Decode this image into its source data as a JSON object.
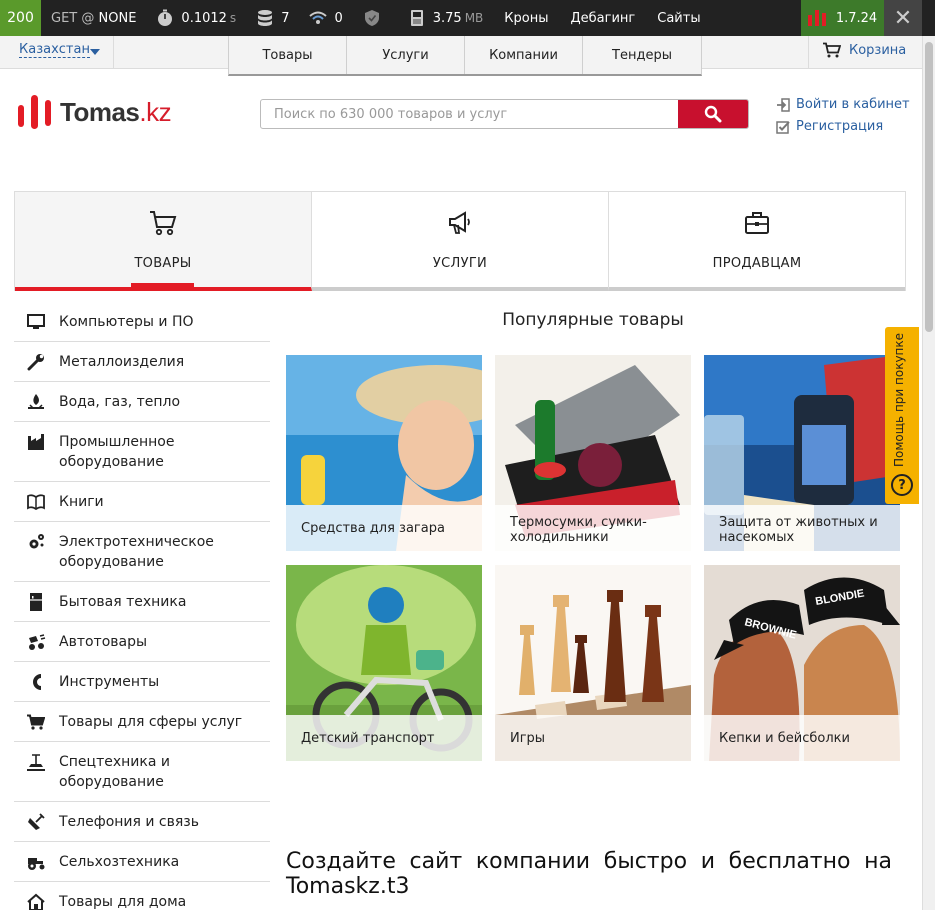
{
  "debug": {
    "status": "200",
    "request_method": "GET @",
    "request_route": "NONE",
    "time": "0.1012",
    "time_unit": "s",
    "db_queries": "7",
    "events": "0",
    "memory": "3.75",
    "memory_unit": "MB",
    "links": [
      "Кроны",
      "Дебагинг",
      "Сайты"
    ],
    "version": "1.7.24",
    "close": "✕"
  },
  "topbar": {
    "region": "Казахстан",
    "nav": [
      "Товары",
      "Услуги",
      "Компании",
      "Тендеры"
    ],
    "cart": "Корзина"
  },
  "header": {
    "logo_main": "Tomas",
    "logo_domain": ".kz",
    "search_placeholder": "Поиск по 630 000 товаров и услуг",
    "search_value": "",
    "login": "Войти в кабинет",
    "register": "Регистрация"
  },
  "category_tabs": [
    {
      "label": "ТОВАРЫ",
      "icon": "cart-icon",
      "active": true
    },
    {
      "label": "УСЛУГИ",
      "icon": "megaphone-icon",
      "active": false
    },
    {
      "label": "ПРОДАВЦАМ",
      "icon": "briefcase-icon",
      "active": false
    }
  ],
  "sidebar": {
    "items": [
      {
        "label": "Компьютеры и ПО",
        "icon": "monitor-icon"
      },
      {
        "label": "Металлоизделия",
        "icon": "wrench-icon"
      },
      {
        "label": "Вода, газ, тепло",
        "icon": "flame-icon"
      },
      {
        "label": "Промышленное оборудование",
        "icon": "factory-icon"
      },
      {
        "label": "Книги",
        "icon": "book-icon"
      },
      {
        "label": "Электротехническое оборудование",
        "icon": "gears-icon"
      },
      {
        "label": "Бытовая техника",
        "icon": "fridge-icon"
      },
      {
        "label": "Автотовары",
        "icon": "car-parts-icon"
      },
      {
        "label": "Инструменты",
        "icon": "magnet-icon"
      },
      {
        "label": "Товары для сферы услуг",
        "icon": "cart-icon"
      },
      {
        "label": "Спецтехника и оборудование",
        "icon": "crane-icon"
      },
      {
        "label": "Телефония и связь",
        "icon": "satellite-icon"
      },
      {
        "label": "Сельхозтехника",
        "icon": "tractor-icon"
      },
      {
        "label": "Товары для дома",
        "icon": "house-icon"
      }
    ]
  },
  "popular": {
    "title": "Популярные товары",
    "cards": [
      {
        "label": "Средства для загара"
      },
      {
        "label": "Термосумки, сумки-холодильники"
      },
      {
        "label": "Защита от животных и насекомых"
      },
      {
        "label": "Детский транспорт"
      },
      {
        "label": "Игры"
      },
      {
        "label": "Кепки и бейсболки"
      }
    ]
  },
  "help_tab": {
    "label": "Помощь при покупке",
    "icon": "?"
  },
  "create_site": {
    "text": "Создайте сайт компании быстро и бесплатно на Tomaskz.t3"
  },
  "colors": {
    "brand_red": "#e31c25",
    "link_blue": "#2a5fa0",
    "help_yellow": "#f5b100",
    "debug_green": "#5a9a2b"
  }
}
